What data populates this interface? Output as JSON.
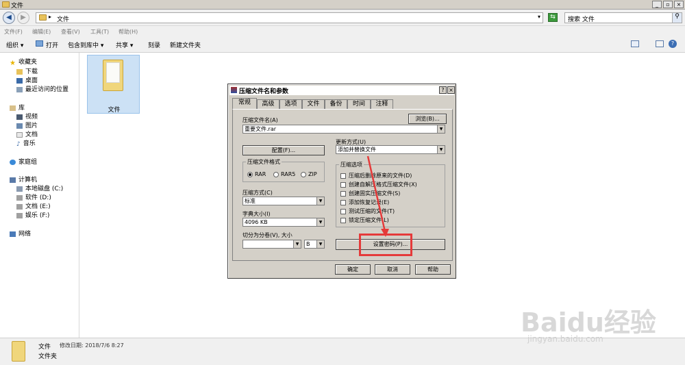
{
  "window": {
    "title": "文件"
  },
  "address": {
    "path": "文件"
  },
  "search": {
    "placeholder": "搜索 文件"
  },
  "menu": [
    "文件(F)",
    "编辑(E)",
    "查看(V)",
    "工具(T)",
    "帮助(H)"
  ],
  "toolbar": [
    "组织 ▾",
    "打开",
    "包含到库中 ▾",
    "共享 ▾",
    "刻录",
    "新建文件夹"
  ],
  "sidebar": {
    "favorites": "收藏夹",
    "fav_items": [
      "下载",
      "桌面",
      "最近访问的位置"
    ],
    "library": "库",
    "lib_items": [
      "视频",
      "图片",
      "文档",
      "音乐"
    ],
    "homegroup": "家庭组",
    "computer": "计算机",
    "comp_items": [
      "本地磁盘 (C:)",
      "软件 (D:)",
      "文档 (E:)",
      "娱乐 (F:)"
    ],
    "network": "网络"
  },
  "content": {
    "folder_name": "文件"
  },
  "status": {
    "name": "文件",
    "modified": "修改日期: 2018/7/6 8:27",
    "type": "文件夹"
  },
  "dialog": {
    "title": "压缩文件名和参数",
    "tabs": [
      "常规",
      "高级",
      "选项",
      "文件",
      "备份",
      "时间",
      "注释"
    ],
    "archive_name_label": "压缩文件名(A)",
    "browse_button": "浏览(B)...",
    "archive_name_value": "重要文件.rar",
    "update_mode_label": "更新方式(U)",
    "update_mode_value": "添加并替换文件",
    "profiles_button": "配置(F)...",
    "format_label": "压缩文件格式",
    "formats": [
      "RAR",
      "RAR5",
      "ZIP"
    ],
    "options_label": "压缩选项",
    "options": [
      "压缩后删除原来的文件(D)",
      "创建自解压格式压缩文件(X)",
      "创建固实压缩文件(S)",
      "添加恢复记录(E)",
      "测试压缩的文件(T)",
      "锁定压缩文件(L)"
    ],
    "method_label": "压缩方式(C)",
    "method_value": "标准",
    "dict_label": "字典大小(I)",
    "dict_value": "4096 KB",
    "split_label": "切分为分卷(V), 大小",
    "split_unit": "B",
    "password_button": "设置密码(P)...",
    "ok_button": "确定",
    "cancel_button": "取消",
    "help_button": "帮助"
  },
  "watermark": {
    "brand": "Baidu经验",
    "url": "jingyan.baidu.com"
  },
  "colors": {
    "highlight": "#e53a3a",
    "selection": "#cce1f5"
  }
}
